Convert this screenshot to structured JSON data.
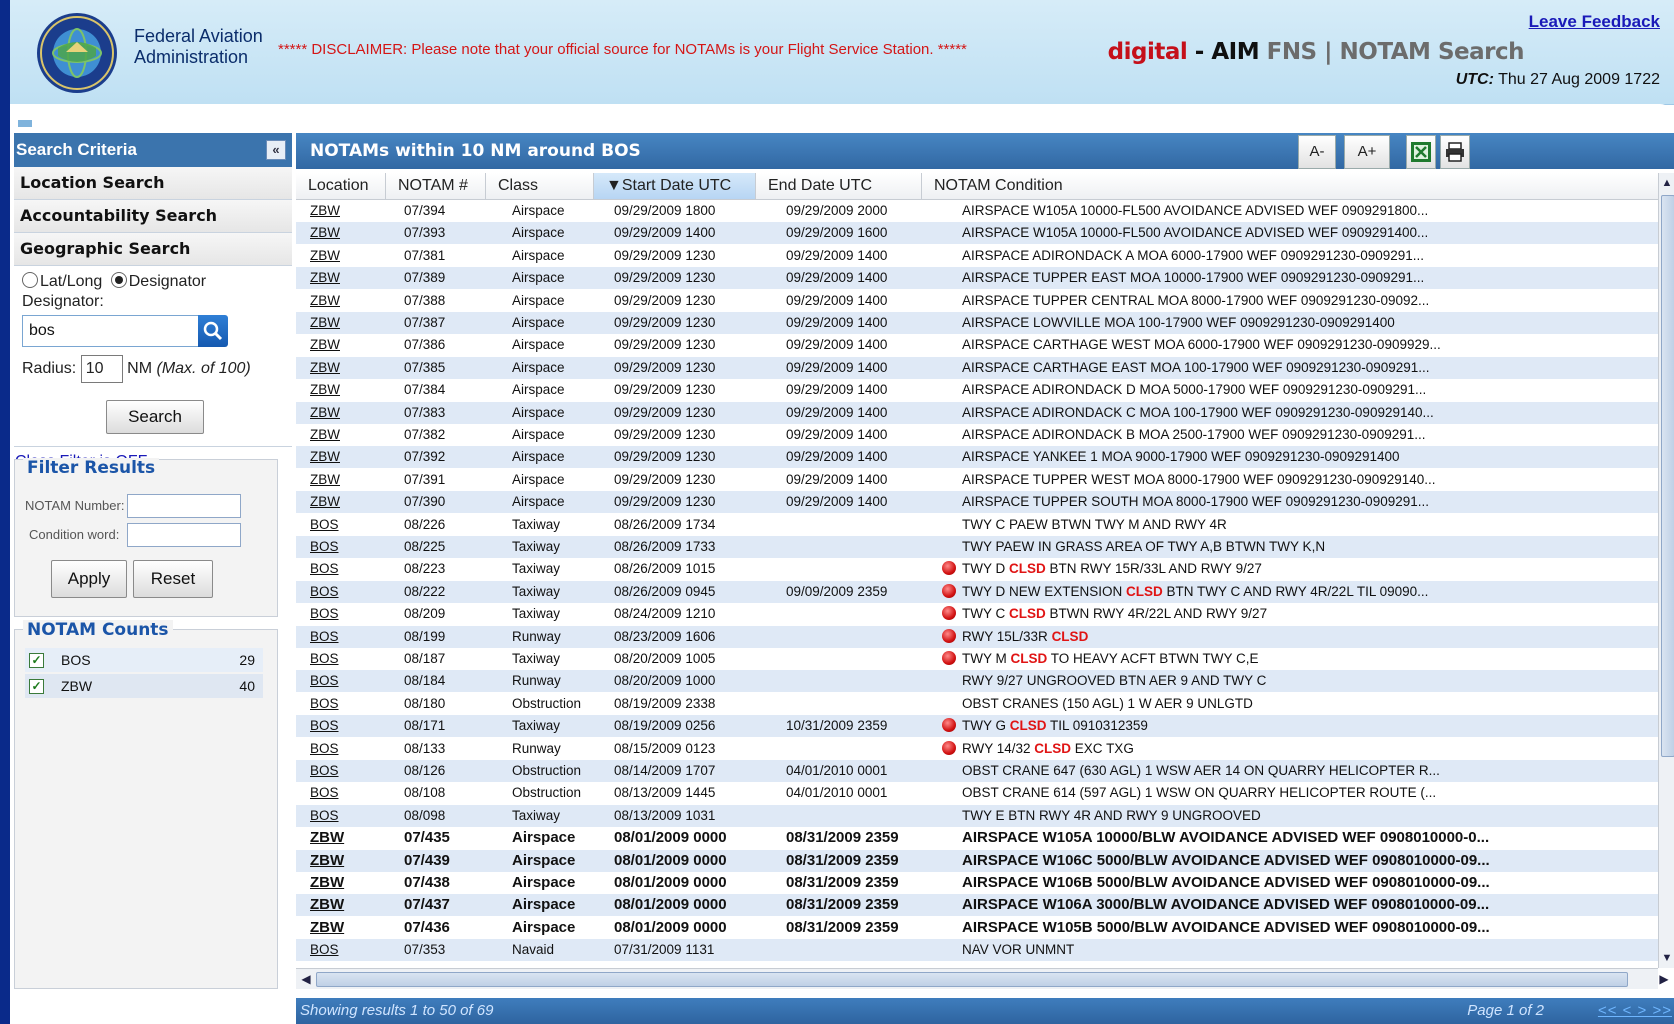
{
  "header": {
    "org_line1": "Federal Aviation",
    "org_line2": "Administration",
    "disclaimer": "***** DISCLAIMER: Please note that your official source for NOTAMs is your Flight Service Station. *****",
    "leave_feedback": "Leave Feedback",
    "brand_digital": "digital",
    "brand_dash": " - ",
    "brand_aim": "AIM",
    "brand_fns": " FNS ",
    "brand_sep": "|",
    "brand_notam": " NOTAM Search",
    "utc_label": "UTC:",
    "utc_value": " Thu 27 Aug 2009 1722"
  },
  "sidebar": {
    "title": "Search Criteria",
    "collapse_glyph": "«",
    "sections": [
      "Location Search",
      "Accountability Search",
      "Geographic Search"
    ],
    "radio_latlong": "Lat/Long",
    "radio_designator": "Designator",
    "designator_label": "Designator:",
    "designator_value": "bos",
    "radius_label": "Radius:",
    "radius_value": "10",
    "radius_unit": "NM",
    "radius_max": "(Max. of 100)",
    "search_button": "Search",
    "class_filter": "Class Filter is OFF",
    "filter_title": "Filter Results",
    "notam_number_label": "NOTAM Number:",
    "condition_word_label": "Condition word:",
    "apply_button": "Apply",
    "reset_button": "Reset",
    "counts_title": "NOTAM Counts",
    "counts": [
      {
        "location": "BOS",
        "count": "29"
      },
      {
        "location": "ZBW",
        "count": "40"
      }
    ]
  },
  "main": {
    "title": "NOTAMs within 10 NM around BOS",
    "font_smaller": "A-",
    "font_larger": "A+",
    "columns": [
      "Location",
      "NOTAM #",
      "Class",
      "▼Start Date UTC",
      "End Date UTC",
      "NOTAM Condition"
    ],
    "rows": [
      {
        "loc": "ZBW",
        "num": "07/394",
        "cls": "Airspace",
        "start": "09/29/2009 1800",
        "end": "09/29/2009 2000",
        "cond": "AIRSPACE W105A 10000-FL500 AVOIDANCE ADVISED WEF 0909291800..."
      },
      {
        "loc": "ZBW",
        "num": "07/393",
        "cls": "Airspace",
        "start": "09/29/2009 1400",
        "end": "09/29/2009 1600",
        "cond": "AIRSPACE W105A 10000-FL500 AVOIDANCE ADVISED WEF 0909291400..."
      },
      {
        "loc": "ZBW",
        "num": "07/381",
        "cls": "Airspace",
        "start": "09/29/2009 1230",
        "end": "09/29/2009 1400",
        "cond": "AIRSPACE ADIRONDACK A MOA 6000-17900 WEF 0909291230-0909291..."
      },
      {
        "loc": "ZBW",
        "num": "07/389",
        "cls": "Airspace",
        "start": "09/29/2009 1230",
        "end": "09/29/2009 1400",
        "cond": "AIRSPACE TUPPER EAST MOA 10000-17900 WEF 0909291230-0909291..."
      },
      {
        "loc": "ZBW",
        "num": "07/388",
        "cls": "Airspace",
        "start": "09/29/2009 1230",
        "end": "09/29/2009 1400",
        "cond": "AIRSPACE TUPPER CENTRAL MOA 8000-17900 WEF 0909291230-09092..."
      },
      {
        "loc": "ZBW",
        "num": "07/387",
        "cls": "Airspace",
        "start": "09/29/2009 1230",
        "end": "09/29/2009 1400",
        "cond": "AIRSPACE LOWVILLE MOA 100-17900 WEF 0909291230-0909291400"
      },
      {
        "loc": "ZBW",
        "num": "07/386",
        "cls": "Airspace",
        "start": "09/29/2009 1230",
        "end": "09/29/2009 1400",
        "cond": "AIRSPACE CARTHAGE WEST MOA 6000-17900 WEF 0909291230-0909929..."
      },
      {
        "loc": "ZBW",
        "num": "07/385",
        "cls": "Airspace",
        "start": "09/29/2009 1230",
        "end": "09/29/2009 1400",
        "cond": "AIRSPACE CARTHAGE EAST MOA 100-17900 WEF 0909291230-0909291..."
      },
      {
        "loc": "ZBW",
        "num": "07/384",
        "cls": "Airspace",
        "start": "09/29/2009 1230",
        "end": "09/29/2009 1400",
        "cond": "AIRSPACE ADIRONDACK D MOA 5000-17900 WEF 0909291230-0909291..."
      },
      {
        "loc": "ZBW",
        "num": "07/383",
        "cls": "Airspace",
        "start": "09/29/2009 1230",
        "end": "09/29/2009 1400",
        "cond": "AIRSPACE ADIRONDACK C MOA 100-17900 WEF 0909291230-090929140..."
      },
      {
        "loc": "ZBW",
        "num": "07/382",
        "cls": "Airspace",
        "start": "09/29/2009 1230",
        "end": "09/29/2009 1400",
        "cond": "AIRSPACE ADIRONDACK B MOA 2500-17900 WEF 0909291230-0909291..."
      },
      {
        "loc": "ZBW",
        "num": "07/392",
        "cls": "Airspace",
        "start": "09/29/2009 1230",
        "end": "09/29/2009 1400",
        "cond": "AIRSPACE YANKEE 1 MOA 9000-17900 WEF 0909291230-0909291400"
      },
      {
        "loc": "ZBW",
        "num": "07/391",
        "cls": "Airspace",
        "start": "09/29/2009 1230",
        "end": "09/29/2009 1400",
        "cond": "AIRSPACE TUPPER WEST MOA 8000-17900 WEF 0909291230-090929140..."
      },
      {
        "loc": "ZBW",
        "num": "07/390",
        "cls": "Airspace",
        "start": "09/29/2009 1230",
        "end": "09/29/2009 1400",
        "cond": "AIRSPACE TUPPER SOUTH MOA 8000-17900 WEF 0909291230-0909291..."
      },
      {
        "loc": "BOS",
        "num": "08/226",
        "cls": "Taxiway",
        "start": "08/26/2009 1734",
        "end": "",
        "cond": "TWY C PAEW BTWN TWY M AND RWY 4R"
      },
      {
        "loc": "BOS",
        "num": "08/225",
        "cls": "Taxiway",
        "start": "08/26/2009 1733",
        "end": "",
        "cond": "TWY PAEW IN GRASS AREA OF TWY A,B BTWN TWY K,N"
      },
      {
        "loc": "BOS",
        "num": "08/223",
        "cls": "Taxiway",
        "start": "08/26/2009 1015",
        "end": "",
        "warn": true,
        "pre": "TWY D ",
        "red": "CLSD",
        "post": " BTN RWY 15R/33L AND RWY 9/27"
      },
      {
        "loc": "BOS",
        "num": "08/222",
        "cls": "Taxiway",
        "start": "08/26/2009 0945",
        "end": "09/09/2009 2359",
        "warn": true,
        "pre": "TWY D NEW EXTENSION ",
        "red": "CLSD",
        "post": " BTN TWY C AND RWY 4R/22L TIL 09090..."
      },
      {
        "loc": "BOS",
        "num": "08/209",
        "cls": "Taxiway",
        "start": "08/24/2009 1210",
        "end": "",
        "warn": true,
        "pre": "TWY C ",
        "red": "CLSD",
        "post": " BTWN RWY 4R/22L AND RWY 9/27"
      },
      {
        "loc": "BOS",
        "num": "08/199",
        "cls": "Runway",
        "start": "08/23/2009 1606",
        "end": "",
        "warn": true,
        "pre": "RWY 15L/33R ",
        "red": "CLSD",
        "post": ""
      },
      {
        "loc": "BOS",
        "num": "08/187",
        "cls": "Taxiway",
        "start": "08/20/2009 1005",
        "end": "",
        "warn": true,
        "pre": "TWY M ",
        "red": "CLSD",
        "post": " TO HEAVY ACFT BTWN TWY C,E"
      },
      {
        "loc": "BOS",
        "num": "08/184",
        "cls": "Runway",
        "start": "08/20/2009 1000",
        "end": "",
        "cond": "RWY 9/27 UNGROOVED BTN AER 9 AND TWY C"
      },
      {
        "loc": "BOS",
        "num": "08/180",
        "cls": "Obstruction",
        "start": "08/19/2009 2338",
        "end": "",
        "cond": "OBST CRANES (150 AGL) 1 W AER 9 UNLGTD"
      },
      {
        "loc": "BOS",
        "num": "08/171",
        "cls": "Taxiway",
        "start": "08/19/2009 0256",
        "end": "10/31/2009 2359",
        "warn": true,
        "pre": "TWY G ",
        "red": "CLSD",
        "post": " TIL 0910312359"
      },
      {
        "loc": "BOS",
        "num": "08/133",
        "cls": "Runway",
        "start": "08/15/2009 0123",
        "end": "",
        "warn": true,
        "pre": "RWY 14/32 ",
        "red": "CLSD",
        "post": " EXC TXG"
      },
      {
        "loc": "BOS",
        "num": "08/126",
        "cls": "Obstruction",
        "start": "08/14/2009 1707",
        "end": "04/01/2010 0001",
        "cond": "OBST CRANE 647 (630 AGL) 1 WSW AER 14 ON QUARRY HELICOPTER R..."
      },
      {
        "loc": "BOS",
        "num": "08/108",
        "cls": "Obstruction",
        "start": "08/13/2009 1445",
        "end": "04/01/2010 0001",
        "cond": "OBST CRANE 614 (597 AGL) 1 WSW ON QUARRY HELICOPTER ROUTE (..."
      },
      {
        "loc": "BOS",
        "num": "08/098",
        "cls": "Taxiway",
        "start": "08/13/2009 1031",
        "end": "",
        "cond": "TWY E BTN RWY 4R AND RWY 9 UNGROOVED"
      },
      {
        "loc": "ZBW",
        "num": "07/435",
        "cls": "Airspace",
        "start": "08/01/2009 0000",
        "end": "08/31/2009 2359",
        "bold": true,
        "cond": "AIRSPACE W105A 10000/BLW AVOIDANCE ADVISED WEF 0908010000-0..."
      },
      {
        "loc": "ZBW",
        "num": "07/439",
        "cls": "Airspace",
        "start": "08/01/2009 0000",
        "end": "08/31/2009 2359",
        "bold": true,
        "cond": "AIRSPACE W106C 5000/BLW AVOIDANCE ADVISED WEF 0908010000-09..."
      },
      {
        "loc": "ZBW",
        "num": "07/438",
        "cls": "Airspace",
        "start": "08/01/2009 0000",
        "end": "08/31/2009 2359",
        "bold": true,
        "cond": "AIRSPACE W106B 5000/BLW AVOIDANCE ADVISED WEF 0908010000-09..."
      },
      {
        "loc": "ZBW",
        "num": "07/437",
        "cls": "Airspace",
        "start": "08/01/2009 0000",
        "end": "08/31/2009 2359",
        "bold": true,
        "cond": "AIRSPACE W106A 3000/BLW AVOIDANCE ADVISED WEF 0908010000-09..."
      },
      {
        "loc": "ZBW",
        "num": "07/436",
        "cls": "Airspace",
        "start": "08/01/2009 0000",
        "end": "08/31/2009 2359",
        "bold": true,
        "cond": "AIRSPACE W105B 5000/BLW AVOIDANCE ADVISED WEF 0908010000-09..."
      },
      {
        "loc": "BOS",
        "num": "07/353",
        "cls": "Navaid",
        "start": "07/31/2009 1131",
        "end": "",
        "cond": "NAV VOR UNMNT"
      }
    ],
    "footer_left": "Showing results 1 to 50 of 69",
    "footer_page": "Page 1 of 2",
    "footer_nav": "<< < > >>"
  },
  "colors": {
    "header_bg": "#cfe8f6",
    "panel_blue": "#3b74ad",
    "disclaimer_red": "#d41616",
    "brand_red": "#c5101a",
    "row_alt": "#dfe9f6",
    "clsd_red": "#e01414"
  }
}
